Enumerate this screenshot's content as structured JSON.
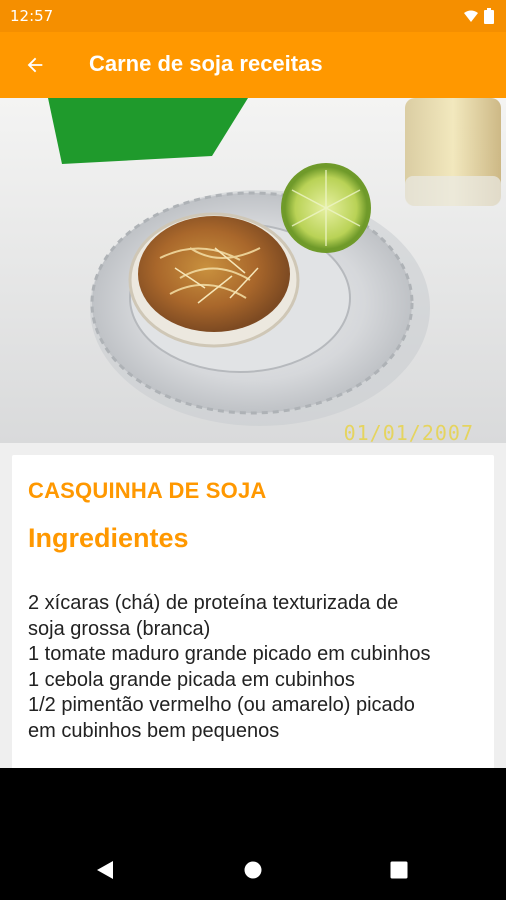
{
  "status_bar": {
    "time": "12:57"
  },
  "app_bar": {
    "title": "Carne de soja receitas",
    "back_icon": "arrow-left-icon"
  },
  "image": {
    "date_stamp": "01/01/2007"
  },
  "recipe": {
    "name": "CASQUINHA DE SOJA",
    "section": "Ingredientes",
    "ingredients_text": "2 xícaras (chá) de proteína texturizada de\nsoja grossa (branca)\n1 tomate maduro grande picado em cubinhos\n1 cebola grande picada em cubinhos\n1/2 pimentão vermelho (ou amarelo) picado\nem cubinhos bem pequenos"
  },
  "colors": {
    "primary": "#FF9800",
    "primary_dark": "#F58F00",
    "text": "#222222"
  },
  "nav_bar": {
    "icons": [
      "back-triangle-icon",
      "home-circle-icon",
      "recents-square-icon"
    ]
  }
}
